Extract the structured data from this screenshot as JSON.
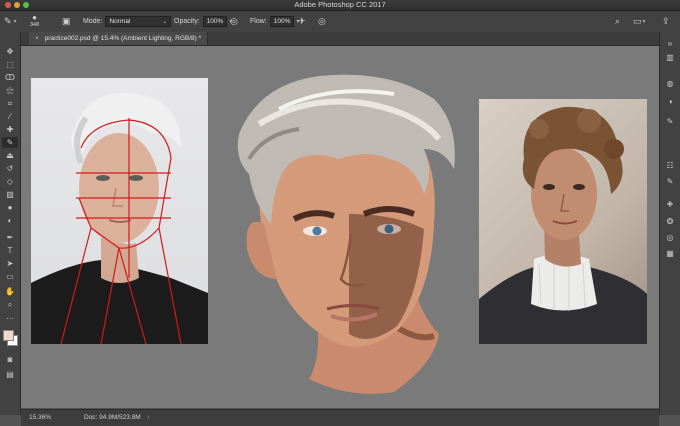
{
  "app": {
    "title": "Adobe Photoshop CC 2017"
  },
  "options_bar": {
    "brush_size": "348",
    "mode_label": "Mode:",
    "mode_value": "Normal",
    "opacity_label": "Opacity:",
    "opacity_value": "100%",
    "flow_label": "Flow:",
    "flow_value": "100%"
  },
  "document": {
    "tab_title": "practice002.psd @ 15.4% (Ambient Lighting, RGB/8) *",
    "tab_close": "×"
  },
  "status": {
    "zoom": "15.36%",
    "doc_size": "Doc: 94.9M/523.8M"
  },
  "toolbar": {
    "tools": [
      "move-icon",
      "marquee-icon",
      "lasso-icon",
      "magic-wand-icon",
      "crop-icon",
      "eyedropper-icon",
      "healing-brush-icon",
      "brush-icon",
      "clone-stamp-icon",
      "history-brush-icon",
      "eraser-icon",
      "gradient-icon",
      "blur-icon",
      "dodge-icon",
      "pen-icon",
      "type-icon",
      "path-selection-icon",
      "rectangle-icon",
      "hand-icon",
      "zoom-icon",
      "more-tools-icon"
    ]
  },
  "colors": {
    "foreground": "#f3d9c9",
    "background": "#ffffff"
  },
  "right_panel": {
    "icons": [
      "histogram-icon",
      "color-wheel-icon",
      "adjustments-icon",
      "brush-settings-icon",
      "properties-icon",
      "layers-icon",
      "channels-icon",
      "paths-icon",
      "swatches-icon"
    ]
  }
}
